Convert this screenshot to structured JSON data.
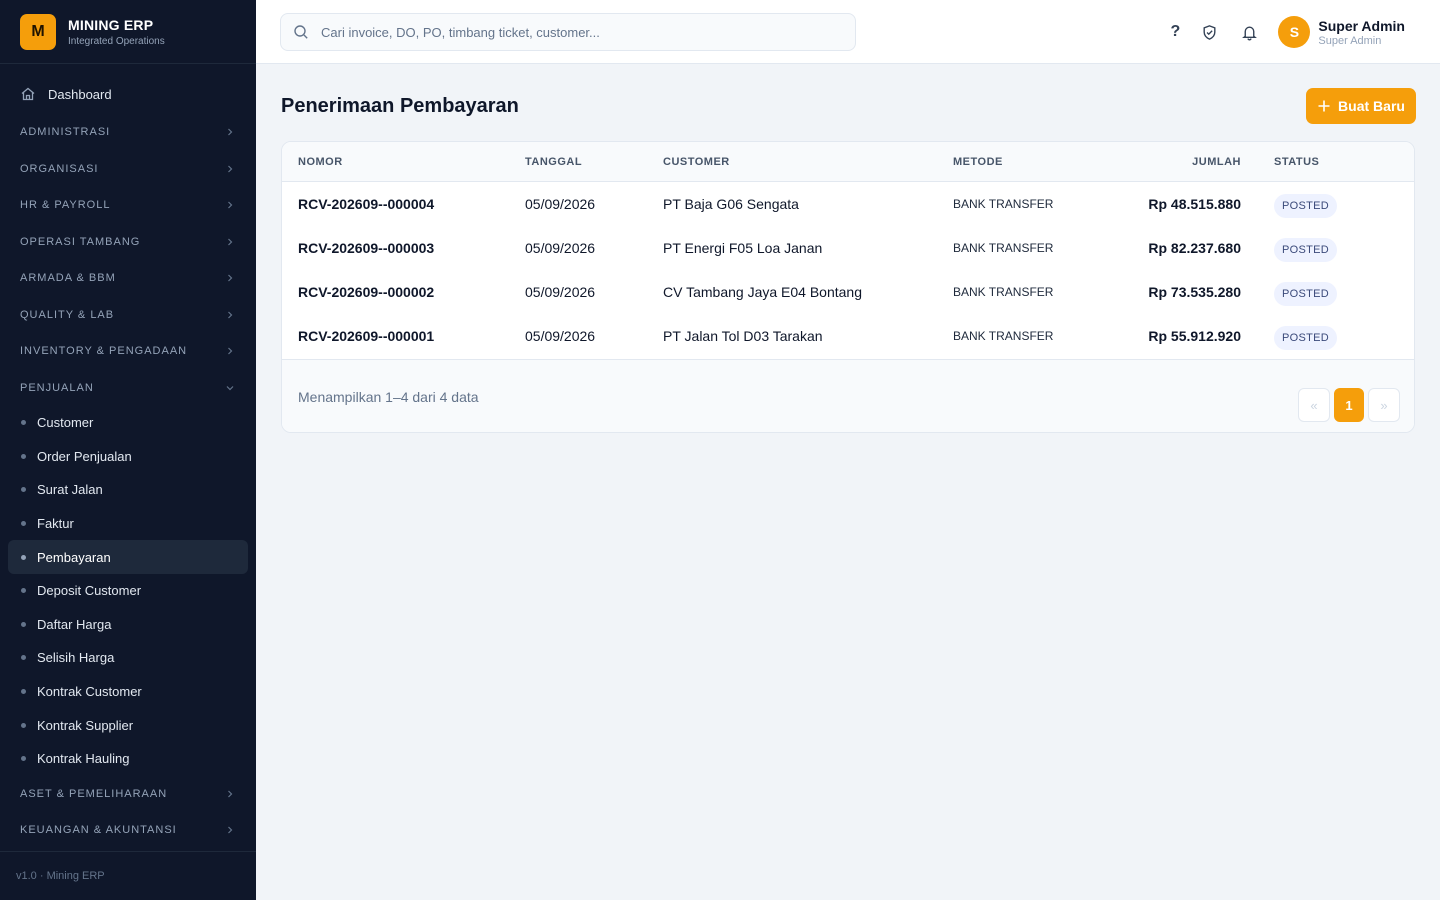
{
  "brand": {
    "logo_letter": "M",
    "name": "MINING ERP",
    "subtitle": "Integrated Operations"
  },
  "sidebar": {
    "dashboard_label": "Dashboard",
    "sections": [
      {
        "label": "ADMINISTRASI",
        "expanded": false
      },
      {
        "label": "ORGANISASI",
        "expanded": false
      },
      {
        "label": "HR & PAYROLL",
        "expanded": false
      },
      {
        "label": "OPERASI TAMBANG",
        "expanded": false
      },
      {
        "label": "ARMADA & BBM",
        "expanded": false
      },
      {
        "label": "QUALITY & LAB",
        "expanded": false
      },
      {
        "label": "INVENTORY & PENGADAAN",
        "expanded": false
      },
      {
        "label": "PENJUALAN",
        "expanded": true
      }
    ],
    "penjualan_items": [
      "Customer",
      "Order Penjualan",
      "Surat Jalan",
      "Faktur",
      "Pembayaran",
      "Deposit Customer",
      "Daftar Harga",
      "Selisih Harga",
      "Kontrak Customer",
      "Kontrak Supplier",
      "Kontrak Hauling"
    ],
    "active_item": "Pembayaran",
    "sections_after": [
      {
        "label": "ASET & PEMELIHARAAN",
        "expanded": false
      },
      {
        "label": "KEUANGAN & AKUNTANSI",
        "expanded": false
      }
    ],
    "footer": "v1.0 · Mining ERP"
  },
  "topbar": {
    "search_placeholder": "Cari invoice, DO, PO, timbang ticket, customer...",
    "help_glyph": "?",
    "user": {
      "initial": "S",
      "name": "Super Admin",
      "role": "Super Admin"
    }
  },
  "page": {
    "title": "Penerimaan Pembayaran",
    "create_button": "Buat Baru"
  },
  "table": {
    "columns": [
      "NOMOR",
      "TANGGAL",
      "CUSTOMER",
      "METODE",
      "JUMLAH",
      "STATUS"
    ],
    "rows": [
      {
        "nomor": "RCV-202609--000004",
        "tanggal": "05/09/2026",
        "customer": "PT Baja G06 Sengata",
        "metode": "BANK TRANSFER",
        "jumlah": "Rp 48.515.880",
        "status": "POSTED"
      },
      {
        "nomor": "RCV-202609--000003",
        "tanggal": "05/09/2026",
        "customer": "PT Energi F05 Loa Janan",
        "metode": "BANK TRANSFER",
        "jumlah": "Rp 82.237.680",
        "status": "POSTED"
      },
      {
        "nomor": "RCV-202609--000002",
        "tanggal": "05/09/2026",
        "customer": "CV Tambang Jaya E04 Bontang",
        "metode": "BANK TRANSFER",
        "jumlah": "Rp 73.535.280",
        "status": "POSTED"
      },
      {
        "nomor": "RCV-202609--000001",
        "tanggal": "05/09/2026",
        "customer": "PT Jalan Tol D03 Tarakan",
        "metode": "BANK TRANSFER",
        "jumlah": "Rp 55.912.920",
        "status": "POSTED"
      }
    ],
    "footer_text": "Menampilkan 1–4 dari 4 data",
    "pagination": {
      "prev": "«",
      "current": "1",
      "next": "»"
    }
  },
  "colors": {
    "accent": "#f59e0b",
    "sidebar_bg": "#0f172a",
    "page_bg": "#f1f4f8"
  },
  "icons": {
    "dashboard": "home-icon",
    "search": "search-icon",
    "shield": "shield-check-icon",
    "bell": "bell-icon"
  }
}
